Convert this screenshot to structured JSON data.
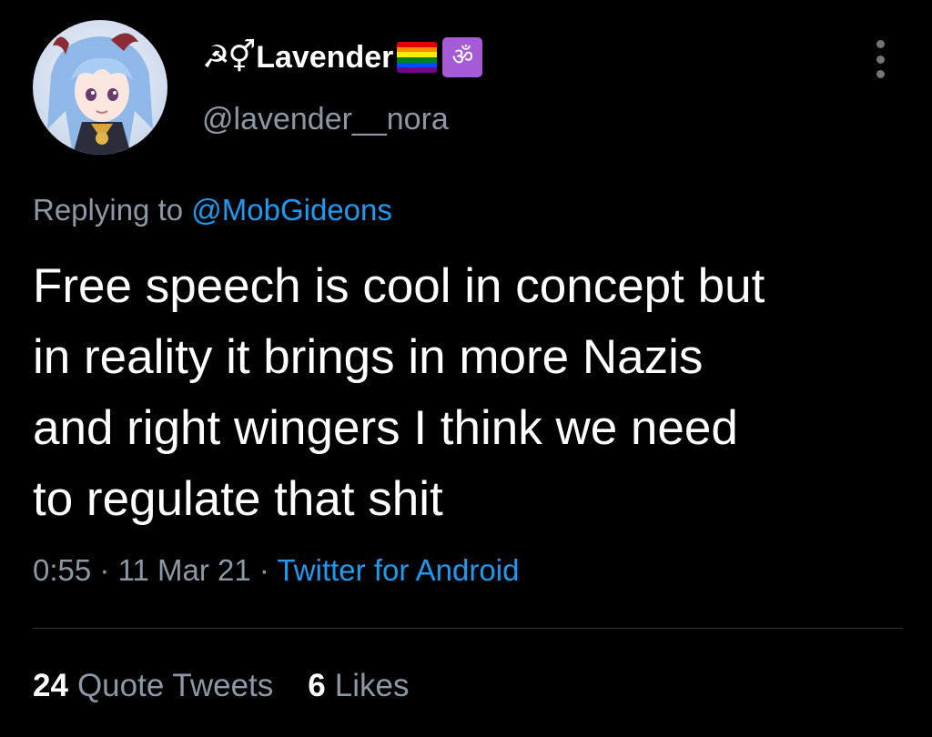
{
  "author": {
    "name_symbols": "☭⚥",
    "display_name": "Lavender",
    "om_symbol": "ॐ",
    "handle": "@lavender__nora"
  },
  "reply": {
    "prefix": "Replying to",
    "mention": "@MobGideons"
  },
  "tweet": {
    "text": "Free speech is cool in concept but\nin reality it brings in more Nazis\nand right wingers I think we need\nto regulate that shit"
  },
  "meta": {
    "time": "0:55",
    "separator": "·",
    "date": "11 Mar 21",
    "source": "Twitter for Android"
  },
  "stats": {
    "quote_count": "24",
    "quote_label": "Quote Tweets",
    "like_count": "6",
    "like_label": "Likes"
  },
  "icons": {
    "avatar": "avatar-anime-character",
    "pride_flag": "rainbow-flag-emoji",
    "om": "om-symbol-emoji",
    "more": "more-options-icon"
  },
  "colors": {
    "background": "#000000",
    "primary_text": "#ffffff",
    "secondary_text": "#8b98a5",
    "link": "#1d9bf0",
    "divider": "#2f3336",
    "om_badge": "#a55bd6",
    "flag": [
      "#e40303",
      "#ff8c00",
      "#ffed00",
      "#008026",
      "#004dff",
      "#750787"
    ]
  }
}
